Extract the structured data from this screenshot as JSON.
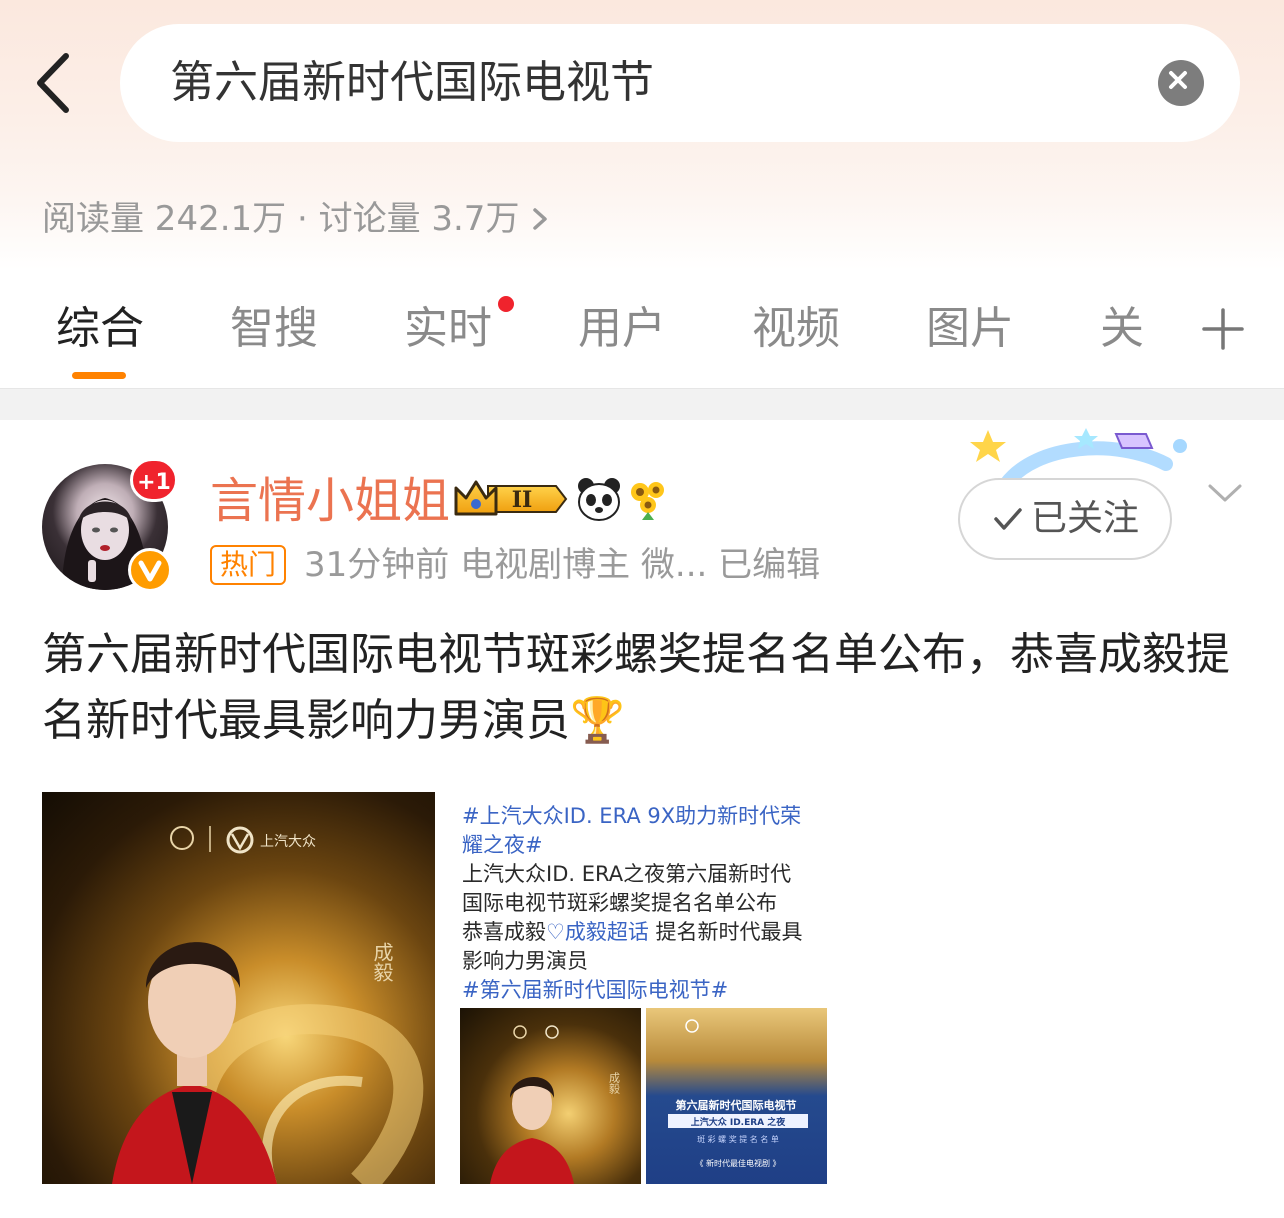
{
  "search": {
    "query": "第六届新时代国际电视节"
  },
  "stats": {
    "text": "阅读量 242.1万 · 讨论量 3.7万"
  },
  "tabs": [
    {
      "label": "综合",
      "active": true
    },
    {
      "label": "智搜",
      "active": false
    },
    {
      "label": "实时",
      "active": false,
      "dot": true
    },
    {
      "label": "用户",
      "active": false
    },
    {
      "label": "视频",
      "active": false
    },
    {
      "label": "图片",
      "active": false
    },
    {
      "label": "关",
      "active": false
    }
  ],
  "post": {
    "avatar_badge": "+1",
    "username": "言情小姐姐",
    "hot_tag": "热门",
    "meta": "31分钟前  电视剧博主 微...  已编辑",
    "follow_label": "已关注",
    "text": "第六届新时代国际电视节斑彩螺奖提名名单公布，恭喜成毅提名新时代最具影响力男演员🏆",
    "image_main": {
      "brand": "上汽大众",
      "name": "成毅"
    },
    "image_side": {
      "lines": [
        {
          "text": "#上汽大众ID. ERA 9X助力新时代荣",
          "style": "blue"
        },
        {
          "text": "耀之夜#",
          "style": "blue"
        },
        {
          "text": "上汽大众ID. ERA之夜第六届新时代",
          "style": "dark"
        },
        {
          "text": "国际电视节斑彩螺奖提名名单公布",
          "style": "dark"
        },
        {
          "text": "恭喜成毅",
          "style": "dark"
        },
        {
          "text": "成毅超话",
          "style": "blue"
        },
        {
          "text": " 提名新时代最具",
          "style": "dark"
        },
        {
          "text": "影响力男演员",
          "style": "dark"
        },
        {
          "text": " #第六届新时代国际电视节#",
          "style": "blue"
        }
      ],
      "thumb1_name": "成毅",
      "thumb2_title": "第六届新时代国际电视节",
      "thumb2_subtitle": "上汽大众 ID.ERA 之夜",
      "thumb2_line": "斑 彩 螺 奖 提 名 名 单",
      "thumb2_award": "《 新时代最佳电视剧 》"
    }
  },
  "colors": {
    "accent": "#ff8200",
    "username": "#eb7350",
    "red_dot": "#f0232d",
    "link_blue": "#3a64c4"
  },
  "icons": [
    "back-chevron-icon",
    "clear-icon",
    "chevron-right-icon",
    "plus-icon",
    "crown-badge-icon",
    "panda-icon",
    "sunflower-icon",
    "check-icon",
    "chevron-down-icon",
    "trophy-icon",
    "vip-v-icon"
  ]
}
